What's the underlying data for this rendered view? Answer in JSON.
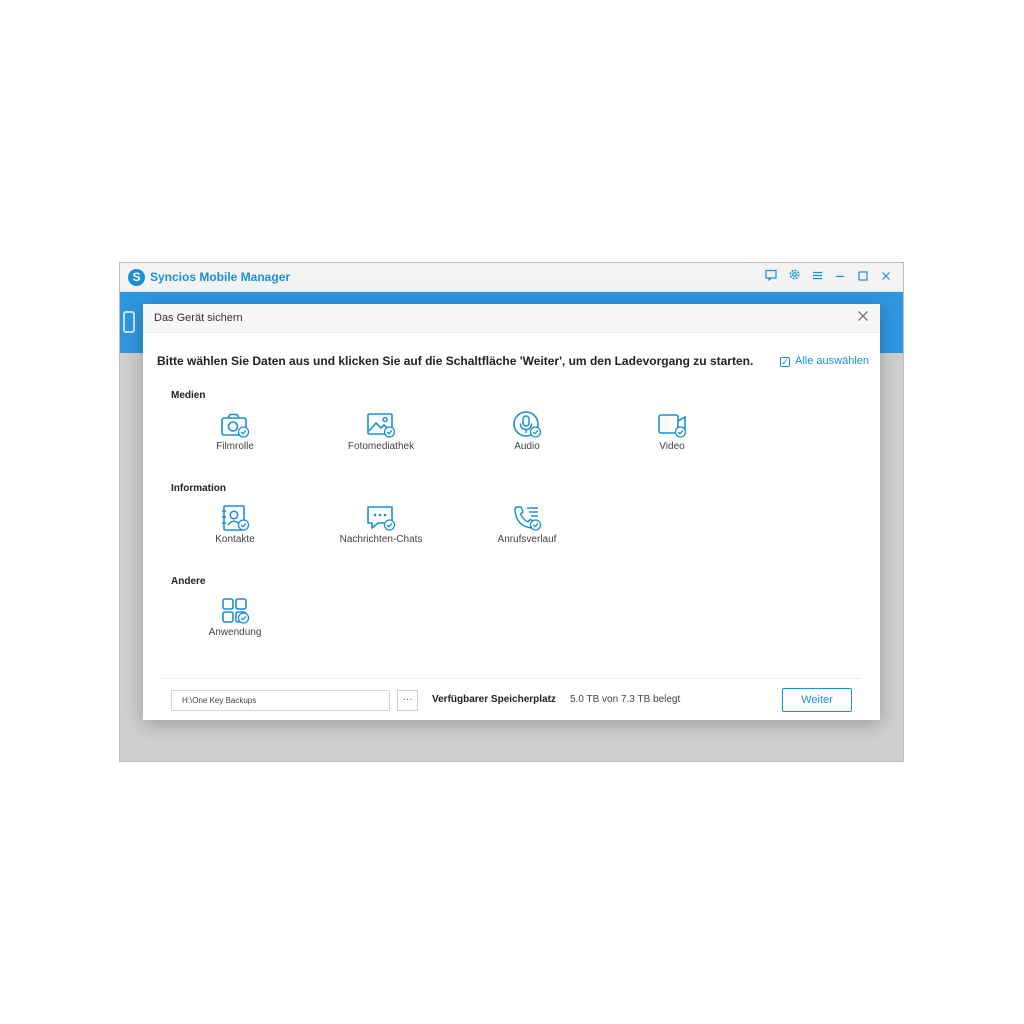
{
  "app": {
    "title": "Syncios Mobile Manager",
    "logo_glyph": "S",
    "accent_color": "#1a8fd8",
    "window_controls": [
      "feedback-icon",
      "gear-icon",
      "menu-icon",
      "minimize-icon",
      "maximize-icon",
      "close-icon"
    ]
  },
  "dialog": {
    "title": "Das Gerät sichern",
    "instruction": "Bitte wählen Sie Daten aus und klicken Sie auf die Schaltfläche 'Weiter', um den Ladevorgang zu starten.",
    "select_all_label": "Alle auswählen",
    "sections": [
      {
        "title": "Medien",
        "items": [
          {
            "label": "Filmrolle",
            "icon": "camera-icon"
          },
          {
            "label": "Fotomediathek",
            "icon": "image-icon"
          },
          {
            "label": "Audio",
            "icon": "microphone-icon"
          },
          {
            "label": "Video",
            "icon": "video-icon"
          }
        ]
      },
      {
        "title": "Information",
        "items": [
          {
            "label": "Kontakte",
            "icon": "contacts-icon"
          },
          {
            "label": "Nachrichten-Chats",
            "icon": "chat-icon"
          },
          {
            "label": "Anrufsverlauf",
            "icon": "call-log-icon"
          }
        ]
      },
      {
        "title": "Andere",
        "items": [
          {
            "label": "Anwendung",
            "icon": "apps-icon"
          }
        ]
      }
    ],
    "footer": {
      "path_value": "H:\\One Key Backups",
      "browse_label": "···",
      "storage_label": "Verfügbarer Speicherplatz",
      "storage_value": "5.0 TB von 7.3 TB belegt",
      "next_label": "Weiter"
    }
  }
}
